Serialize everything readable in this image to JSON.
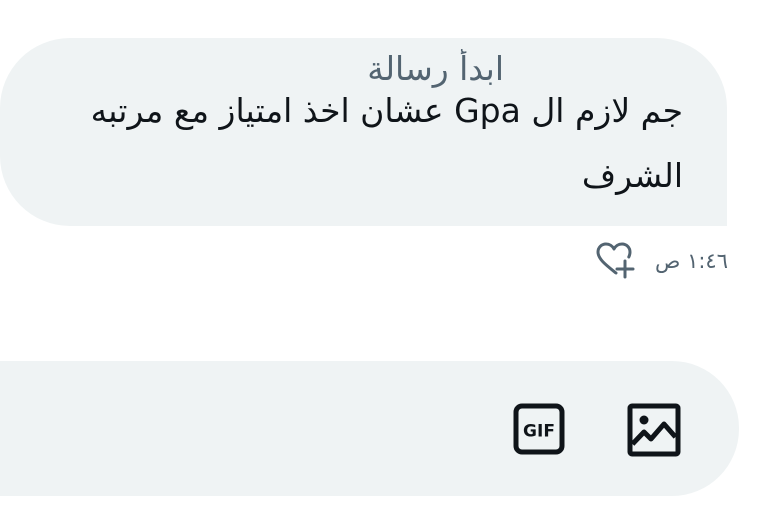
{
  "conversation": {
    "message": {
      "line1": "جم لازم ال Gpa عشان اخذ امتياز مع مرتبه",
      "line2": "الشرف",
      "timestamp": "١:٤٦ ص",
      "reaction_icon": "heart-plus-icon"
    }
  },
  "composer": {
    "placeholder": "ابدأ رسالة",
    "gif_icon": "gif-icon",
    "gif_text": "GIF",
    "media_icon": "image-icon"
  },
  "colors": {
    "bubble_background": "#eff3f4",
    "text_primary": "#0f1419",
    "text_secondary": "#536471",
    "icon_color": "#0f1419"
  }
}
